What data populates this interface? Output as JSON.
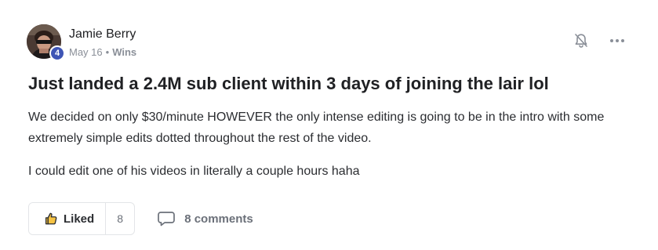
{
  "post": {
    "author": {
      "name": "Jamie Berry",
      "level": "4",
      "avatar_icon": "user-avatar-photo"
    },
    "date": "May 16",
    "separator": "•",
    "category": "Wins",
    "title": "Just landed a 2.4M sub client within 3 days of joining the lair lol",
    "body": [
      "We decided on only $30/minute HOWEVER the only intense editing is going to be in the intro with some extremely simple edits dotted throughout the rest of the video.",
      "I could edit one of his videos in literally a couple hours haha"
    ],
    "actions": {
      "notify_icon": "bell-off-icon",
      "more_icon": "more-horizontal-icon"
    },
    "footer": {
      "like_label": "Liked",
      "like_count": "8",
      "comments_label": "8 comments"
    }
  },
  "colors": {
    "badge": "#3f55b5",
    "text": "#202124",
    "muted": "#8a8f98",
    "border": "#e3e5e8"
  }
}
